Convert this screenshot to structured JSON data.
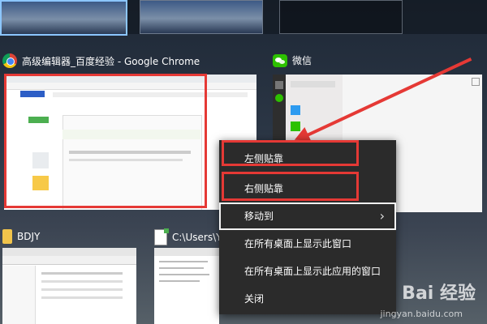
{
  "windows": [
    {
      "title": "高级编辑器_百度经验 - Google Chrome",
      "icon": "chrome-icon"
    },
    {
      "title": "微信",
      "icon": "wechat-icon"
    },
    {
      "title": "BDJY",
      "icon": "folder-icon"
    },
    {
      "title": "C:\\Users\\Y",
      "icon": "notepad-icon"
    }
  ],
  "context_menu": {
    "items": [
      {
        "label": "左侧贴靠"
      },
      {
        "label": "右侧贴靠"
      },
      {
        "label": "移动到",
        "submenu": true
      },
      {
        "label": "在所有桌面上显示此窗口"
      },
      {
        "label": "在所有桌面上显示此应用的窗口"
      },
      {
        "label": "关闭"
      }
    ]
  },
  "watermark": {
    "text": "Bai 经验",
    "sub": "jingyan.baidu.com"
  },
  "colors": {
    "highlight_frame": "#e53935",
    "menu_bg": "#2b2b2b",
    "accent": "#8cc6ff"
  }
}
